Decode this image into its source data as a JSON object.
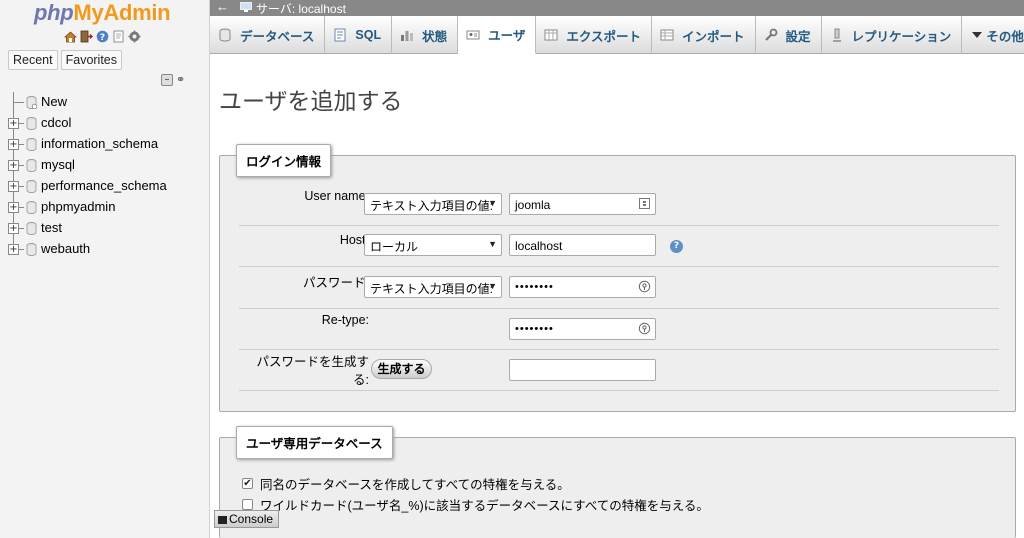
{
  "nav": {
    "logo_php": "php",
    "logo_myadmin": "MyAdmin",
    "tabs": [
      "Recent",
      "Favorites"
    ],
    "icons": [
      "home-icon",
      "exit-icon",
      "help-icon",
      "docs-icon",
      "settings-icon"
    ],
    "tree": [
      {
        "label": "New"
      },
      {
        "label": "cdcol"
      },
      {
        "label": "information_schema"
      },
      {
        "label": "mysql"
      },
      {
        "label": "performance_schema"
      },
      {
        "label": "phpmyadmin"
      },
      {
        "label": "test"
      },
      {
        "label": "webauth"
      }
    ]
  },
  "topbar": {
    "back": "←",
    "server": "サーバ: localhost"
  },
  "menu": {
    "tabs": [
      {
        "label": "データベース",
        "icon": "database-icon"
      },
      {
        "label": "SQL",
        "icon": "sql-icon"
      },
      {
        "label": "状態",
        "icon": "status-icon"
      },
      {
        "label": "ユーザ",
        "icon": "users-icon",
        "active": true
      },
      {
        "label": "エクスポート",
        "icon": "export-icon"
      },
      {
        "label": "インポート",
        "icon": "import-icon"
      },
      {
        "label": "設定",
        "icon": "settings-wrench-icon"
      },
      {
        "label": "レプリケーション",
        "icon": "replication-icon"
      },
      {
        "label": "その他",
        "icon": "more-icon"
      }
    ]
  },
  "main": {
    "title": "ユーザを追加する",
    "login": {
      "legend": "ログイン情報",
      "username": {
        "label": "User name:",
        "select": "テキスト入力項目の値:",
        "value": "joomla"
      },
      "host": {
        "label": "Host:",
        "select": "ローカル",
        "value": "localhost"
      },
      "password": {
        "label": "パスワード:",
        "select": "テキスト入力項目の値:",
        "value": "••••••••"
      },
      "retype": {
        "label": "Re-type:",
        "value": "••••••••"
      },
      "generate": {
        "label_line1": "パスワードを生成す",
        "label_line2": "る:",
        "button": "生成する",
        "value": ""
      }
    },
    "userdb": {
      "legend": "ユーザ専用データベース",
      "options": [
        {
          "label": "同名のデータベースを作成してすべての特権を与える。",
          "checked": true
        },
        {
          "label": "ワイルドカード(ユーザ名_%)に該当するデータベースにすべての特権を与える。",
          "checked": false
        }
      ]
    }
  },
  "console": {
    "label": "Console"
  },
  "colors": {
    "tab_text": "#235a81",
    "logo_php": "#6c78af",
    "logo_myadmin": "#f29a1f",
    "topbar_bg": "#888888",
    "fieldset_bg": "#eeeeee"
  }
}
